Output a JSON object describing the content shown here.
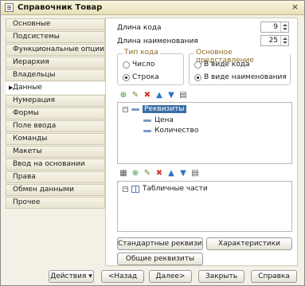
{
  "window": {
    "title": "Справочник Товар",
    "close_glyph": "×"
  },
  "nav": {
    "items": [
      {
        "label": "Основные",
        "name": "nav-item-osnovnye"
      },
      {
        "label": "Подсистемы",
        "name": "nav-item-podsistemy"
      },
      {
        "label": "Функциональные опции",
        "name": "nav-item-funkcionalnye-opcii"
      },
      {
        "label": "Иерархия",
        "name": "nav-item-ierarhiya"
      },
      {
        "label": "Владельцы",
        "name": "nav-item-vladelcy"
      },
      {
        "label": "Данные",
        "name": "nav-item-dannye",
        "active": true
      },
      {
        "label": "Нумерация",
        "name": "nav-item-numeraciya"
      },
      {
        "label": "Формы",
        "name": "nav-item-formy"
      },
      {
        "label": "Поле ввода",
        "name": "nav-item-pole-vvoda"
      },
      {
        "label": "Команды",
        "name": "nav-item-komandy"
      },
      {
        "label": "Макеты",
        "name": "nav-item-makety"
      },
      {
        "label": "Ввод на основании",
        "name": "nav-item-vvod-na-osnovanii"
      },
      {
        "label": "Права",
        "name": "nav-item-prava"
      },
      {
        "label": "Обмен данными",
        "name": "nav-item-obmen-dannymi"
      },
      {
        "label": "Прочее",
        "name": "nav-item-prochee"
      }
    ]
  },
  "data": {
    "code_length_label": "Длина кода",
    "code_length_value": "9",
    "name_length_label": "Длина наименования",
    "name_length_value": "25",
    "code_type": {
      "title": "Тип кода",
      "option_number": "Число",
      "option_string": "Строка",
      "selected": "Строка"
    },
    "main_view": {
      "title": "Основное представление",
      "option_code": "В виде кода",
      "option_name": "В виде наименования",
      "selected": "В виде наименования"
    },
    "attributes_tree": {
      "root_label": "Реквизиты",
      "children": [
        "Цена",
        "Количество"
      ]
    },
    "tabular_tree": {
      "root_label": "Табличные части"
    },
    "buttons": {
      "standard_attributes": "Стандартные реквизиты",
      "characteristics": "Характеристики",
      "common_attributes": "Общие реквизиты"
    }
  },
  "bottom": {
    "actions": "Действия",
    "actions_arrow": "▾",
    "back": "<Назад",
    "next": "Далее>",
    "close": "Закрыть",
    "help": "Справка"
  },
  "colors": {
    "window_bg": "#f3f0e6",
    "panel_bg": "#ffffff",
    "selection": "#3a6ea5",
    "group_title": "#8a6a1a",
    "add_icon": "#2e9b2e",
    "delete_icon": "#d23a2a",
    "move_icon": "#2f72c4"
  }
}
